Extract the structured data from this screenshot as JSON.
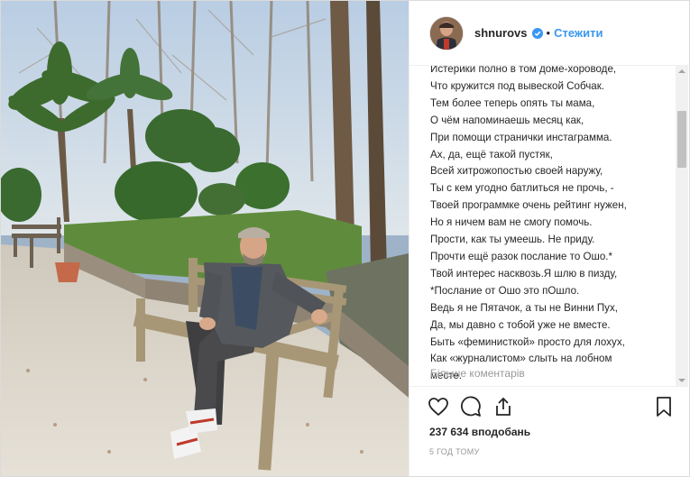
{
  "post": {
    "username": "shnurovs",
    "separator": "•",
    "follow_label": "Стежити",
    "verified_icon": "verified-badge-icon",
    "caption_lines": [
      "Истерики полно в том доме-хороводе,",
      "Что кружится под вывеской Собчак.",
      "Тем более теперь опять ты мама,",
      "О чём напоминаешь месяц как,",
      "При помощи странички инстаграмма.",
      "Ах, да, ещё такой пустяк,",
      "Всей хитрожопостью своей наружу,",
      "Ты с кем угодно батлиться не прочь, -",
      "Твоей программке очень рейтинг нужен,",
      "Но я ничем вам не смогу помочь.",
      "Прости, как ты умеешь. Не приду.",
      "Прочти ещё разок послание то Ошо.*",
      "Твой интерес насквозь.Я шлю в пизду,",
      "*Послание от Ошо это пОшло.",
      "Ведь я не Пятачок, а ты не Винни Пух,",
      "Да, мы давно с тобой уже не вместе.",
      "Быть «феминисткой» просто для лохух,",
      "Как «журналистом» слыть на лобном",
      "месте."
    ],
    "more_comments_label": "Більше коментарів",
    "likes_text": "237 634 вподобань",
    "timestamp": "5 ГОД ТОМУ"
  },
  "icons": {
    "like": "heart-icon",
    "comment": "comment-icon",
    "share": "share-icon",
    "save": "bookmark-icon"
  },
  "colors": {
    "accent": "#3897f0",
    "text": "#262626",
    "muted": "#999999"
  }
}
